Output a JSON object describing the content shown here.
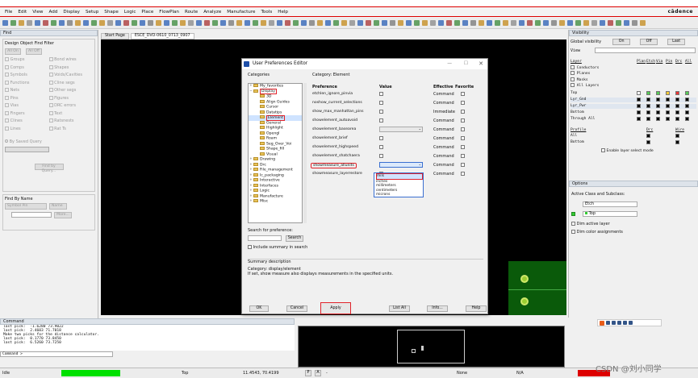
{
  "menu": [
    "File",
    "Edit",
    "View",
    "Add",
    "Display",
    "Setup",
    "Shape",
    "Logic",
    "Place",
    "FlowPlan",
    "Route",
    "Analyze",
    "Manufacture",
    "Tools",
    "Help"
  ],
  "brand": "cādence",
  "find": {
    "title": "Find",
    "filter_title": "Design Object Find Filter",
    "all_on": "All On",
    "all_off": "All Off",
    "left": [
      "Groups",
      "Comps",
      "Symbols",
      "Functions",
      "Nets",
      "Pins",
      "Vias",
      "Fingers",
      "Clines",
      "Lines"
    ],
    "right": [
      "Bond wires",
      "Shapes",
      "Voids/Cavities",
      "Cline segs",
      "Other segs",
      "Figures",
      "DRC errors",
      "Text",
      "Ratsnests",
      "Rat Ts"
    ],
    "saved_query": "By Saved Query",
    "find_by_query": "Find by Query...",
    "find_by_name": "Find By Name",
    "symbol_pin": "Symbol Pin",
    "name": "Name",
    "more": "More..."
  },
  "tabs": [
    "Start Page",
    "ESCE_DVO-0610_0713_0907"
  ],
  "dialog": {
    "title": "User Preferences Editor",
    "categories": "Categories",
    "category_label": "Category:  Element",
    "tree": [
      {
        "t": "My_favorites",
        "d": 1
      },
      {
        "t": "Display",
        "d": 1
      },
      {
        "t": "3D",
        "d": 2
      },
      {
        "t": "Align Guides",
        "d": 2
      },
      {
        "t": "Cursor",
        "d": 2
      },
      {
        "t": "Datatips",
        "d": 2
      },
      {
        "t": "Element",
        "d": 2
      },
      {
        "t": "General",
        "d": 2
      },
      {
        "t": "Highlight",
        "d": 2
      },
      {
        "t": "Opengl",
        "d": 2
      },
      {
        "t": "Roam",
        "d": 2
      },
      {
        "t": "Seg_Over_Voi",
        "d": 2
      },
      {
        "t": "Shape_fill",
        "d": 2
      },
      {
        "t": "Visual",
        "d": 2
      },
      {
        "t": "Drawing",
        "d": 1
      },
      {
        "t": "Drc",
        "d": 1
      },
      {
        "t": "File_management",
        "d": 1
      },
      {
        "t": "Ic_packaging",
        "d": 1
      },
      {
        "t": "Interactive",
        "d": 1
      },
      {
        "t": "Interfaces",
        "d": 1
      },
      {
        "t": "Logic",
        "d": 1
      },
      {
        "t": "Manufacture",
        "d": 1
      },
      {
        "t": "Misc",
        "d": 1
      }
    ],
    "cols": {
      "pref": "Preference",
      "value": "Value",
      "effective": "Effective",
      "favorite": "Favorite"
    },
    "rows": [
      {
        "n": "etchlen_ignore_pinvia",
        "e": "Command"
      },
      {
        "n": "noshow_current_selections",
        "e": "Command"
      },
      {
        "n": "show_max_manhattan_pins",
        "e": "Immediate"
      },
      {
        "n": "showelement_autoavoid",
        "e": "Command"
      },
      {
        "n": "showelement_basearea",
        "e": "Command"
      },
      {
        "n": "showelement_brief",
        "e": "Command"
      },
      {
        "n": "showelement_highspeed",
        "e": "Command"
      },
      {
        "n": "showelement_shatchaera",
        "e": "Command"
      },
      {
        "n": "showmeasure_allunits",
        "e": "Command"
      },
      {
        "n": "showmeasure_layerrestore",
        "e": "Command"
      }
    ],
    "units": [
      "mils",
      "inches",
      "millimeters",
      "centimeters",
      "microns"
    ],
    "search_label": "Search for preference:",
    "search_btn": "Search",
    "include_summary": "Include summary in search",
    "summary_title": "Summary description",
    "summary_cat": "Category: display/element",
    "summary_text": "If set, show measure also displays measurements in the specified units.",
    "buttons": {
      "ok": "OK",
      "cancel": "Cancel",
      "apply": "Apply",
      "list": "List All",
      "info": "Info...",
      "help": "Help"
    }
  },
  "visibility": {
    "title": "Visibility",
    "global": "Global visibility",
    "on": "On",
    "off": "Off",
    "last": "Last",
    "view": "View",
    "header": [
      "Layer",
      "Plan",
      "Etch",
      "Via",
      "Pin",
      "Drc",
      "All"
    ],
    "groups": [
      "Conductors",
      "Planes",
      "Masks",
      "All Layers"
    ],
    "layers": [
      "Top",
      "Lyr_Gnd",
      "Lyr_Pwr",
      "Bottom",
      "Through All"
    ],
    "profile": [
      "Profile",
      "Drc",
      "Wire"
    ],
    "profile_rows": [
      "All",
      "Bottom"
    ],
    "enable_layer": "Enable layer select mode"
  },
  "options": {
    "title": "Options",
    "active": "Active Class and Subclass:",
    "class": "Etch",
    "subclass": "Top",
    "dim_active": "Dim active layer",
    "dim_color": "Dim color assignments"
  },
  "command": {
    "title": "Command",
    "lines": [
      "last pick:  -1.6280 73.9022",
      "last pick:  2.4603 71.7018",
      "Make two picks for the distance calculator.",
      "last pick:  0.1770 73.8450",
      "last pick:  6.5260 73.7250"
    ],
    "prompt": "Command >"
  },
  "status": {
    "idle": "Idle",
    "layer": "Top",
    "coords": "11.4543, 70.4199",
    "p": "P",
    "a": "A",
    "dash": "-",
    "none": "None",
    "na": "N/A"
  },
  "watermark": "CSDN @刘小同学"
}
